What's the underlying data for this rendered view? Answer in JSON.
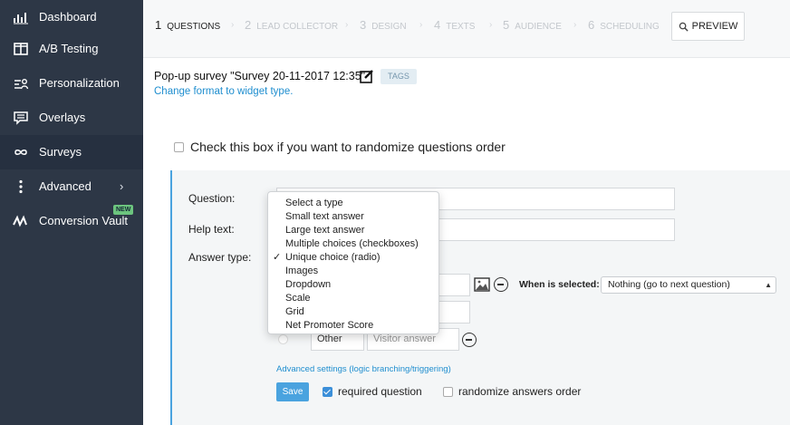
{
  "sidebar": {
    "items": [
      {
        "label": "Dashboard",
        "icon": "bar-chart-icon"
      },
      {
        "label": "A/B Testing",
        "icon": "split-layout-icon"
      },
      {
        "label": "Personalization",
        "icon": "personalization-icon"
      },
      {
        "label": "Overlays",
        "icon": "overlay-message-icon"
      },
      {
        "label": "Surveys",
        "icon": "infinity-icon"
      },
      {
        "label": "Advanced",
        "icon": "vertical-dots-icon"
      },
      {
        "label": "Conversion Vault",
        "icon": "vault-waves-icon",
        "badge": "NEW"
      }
    ]
  },
  "steps": [
    {
      "num": "1",
      "label": "QUESTIONS"
    },
    {
      "num": "2",
      "label": "LEAD COLLECTOR"
    },
    {
      "num": "3",
      "label": "DESIGN"
    },
    {
      "num": "4",
      "label": "TEXTS"
    },
    {
      "num": "5",
      "label": "AUDIENCE"
    },
    {
      "num": "6",
      "label": "SCHEDULING"
    }
  ],
  "preview_label": "PREVIEW",
  "survey": {
    "title": "Pop-up survey \"Survey 20-11-2017 12:35\"",
    "tags_label": "TAGS",
    "change_format_link": "Change format to widget type."
  },
  "randomize_questions_label": "Check this box if you want to randomize questions order",
  "question_form": {
    "question_label": "Question:",
    "help_label": "Help text:",
    "answer_type_label": "Answer type:",
    "when_selected_label": "When is selected:",
    "when_selected_value": "Nothing (go to next question)",
    "other_value": "Other",
    "visitor_answer_placeholder": "Visitor answer",
    "advanced_link": "Advanced settings (logic branching/triggering)",
    "save_label": "Save",
    "required_label": "required question",
    "randomize_answers_label": "randomize answers order"
  },
  "answer_type_dropdown": {
    "selected": "Unique choice (radio)",
    "options": [
      "Select a type",
      "Small text answer",
      "Large text answer",
      "Multiple choices (checkboxes)",
      "Unique choice (radio)",
      "Images",
      "Dropdown",
      "Scale",
      "Grid",
      "Net Promoter Score"
    ]
  },
  "colors": {
    "sidebar_bg": "#2d3746",
    "accent": "#4aa3df",
    "link": "#1f8ecf"
  }
}
